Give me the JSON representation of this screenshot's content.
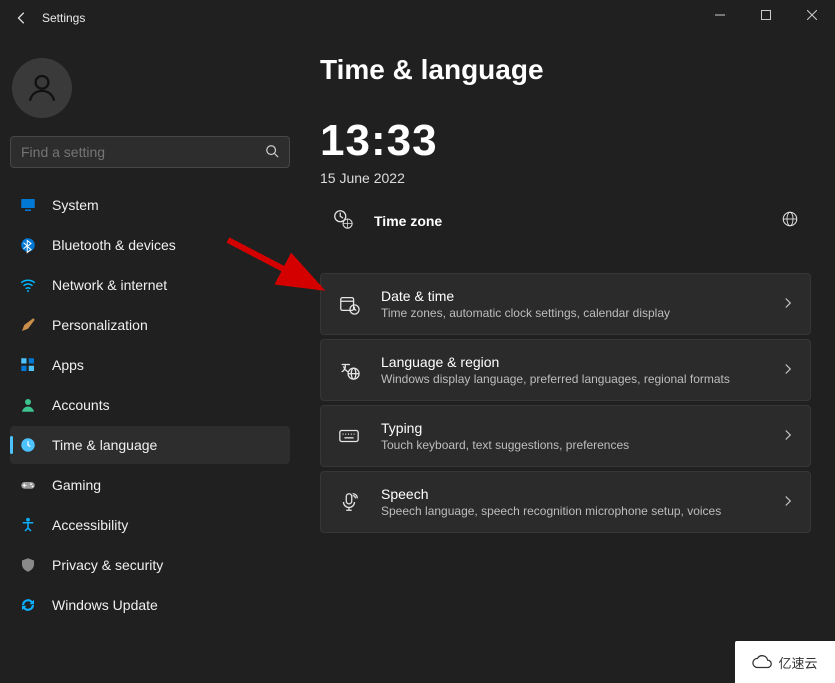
{
  "window": {
    "title": "Settings"
  },
  "search": {
    "placeholder": "Find a setting"
  },
  "sidebar": {
    "items": [
      {
        "label": "System",
        "icon": "monitor"
      },
      {
        "label": "Bluetooth & devices",
        "icon": "bluetooth"
      },
      {
        "label": "Network & internet",
        "icon": "wifi"
      },
      {
        "label": "Personalization",
        "icon": "brush"
      },
      {
        "label": "Apps",
        "icon": "apps"
      },
      {
        "label": "Accounts",
        "icon": "person"
      },
      {
        "label": "Time & language",
        "icon": "clock"
      },
      {
        "label": "Gaming",
        "icon": "gamepad"
      },
      {
        "label": "Accessibility",
        "icon": "access"
      },
      {
        "label": "Privacy & security",
        "icon": "shield"
      },
      {
        "label": "Windows Update",
        "icon": "update"
      }
    ],
    "selected_index": 6
  },
  "page": {
    "title": "Time & language",
    "clock": "13:33",
    "date": "15 June 2022",
    "timezone_label": "Time zone"
  },
  "cards": [
    {
      "title": "Date & time",
      "desc": "Time zones, automatic clock settings, calendar display",
      "icon": "calendar-clock"
    },
    {
      "title": "Language & region",
      "desc": "Windows display language, preferred languages, regional formats",
      "icon": "lang-globe"
    },
    {
      "title": "Typing",
      "desc": "Touch keyboard, text suggestions, preferences",
      "icon": "keyboard"
    },
    {
      "title": "Speech",
      "desc": "Speech language, speech recognition microphone setup, voices",
      "icon": "mic"
    }
  ],
  "watermark": {
    "text": "亿速云"
  }
}
